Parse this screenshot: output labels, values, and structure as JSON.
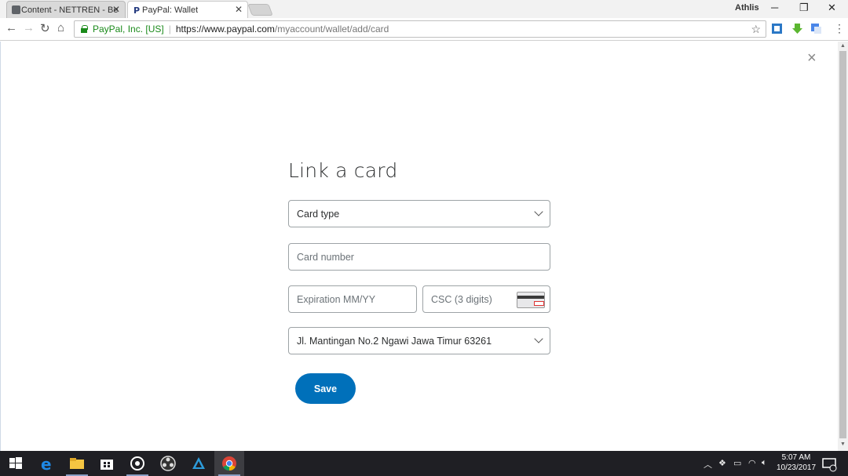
{
  "browser": {
    "tabs": [
      {
        "label": "Content - NETTREN - Be",
        "icon": "document-icon"
      },
      {
        "label": "PayPal: Wallet",
        "icon": "paypal-icon"
      }
    ],
    "user_name": "Athlis",
    "window_controls": {
      "minimize": "─",
      "restore": "❐",
      "close": "✕"
    },
    "address": {
      "secure_label": "PayPal, Inc. [US]",
      "url_host": "https://www.paypal.com",
      "url_path": "/myaccount/wallet/add/card"
    }
  },
  "page": {
    "close_symbol": "×",
    "title": "Link a card",
    "card_type": {
      "value": "Card type"
    },
    "card_number": {
      "placeholder": "Card number"
    },
    "expiration": {
      "placeholder": "Expiration MM/YY"
    },
    "csc": {
      "placeholder": "CSC (3 digits)"
    },
    "address": {
      "value": "Jl. Mantingan No.2 Ngawi Jawa Timur 63261"
    },
    "save_label": "Save",
    "colors": {
      "primary": "#0070ba",
      "heading": "#2c2e2f",
      "border": "#9da3a6"
    }
  },
  "taskbar": {
    "time": "5:07 AM",
    "date": "10/23/2017",
    "apps": [
      "windows-start-icon",
      "edge-icon",
      "file-explorer-icon",
      "store-icon",
      "app-icon",
      "obs-icon",
      "vector-app-icon",
      "chrome-icon"
    ]
  }
}
